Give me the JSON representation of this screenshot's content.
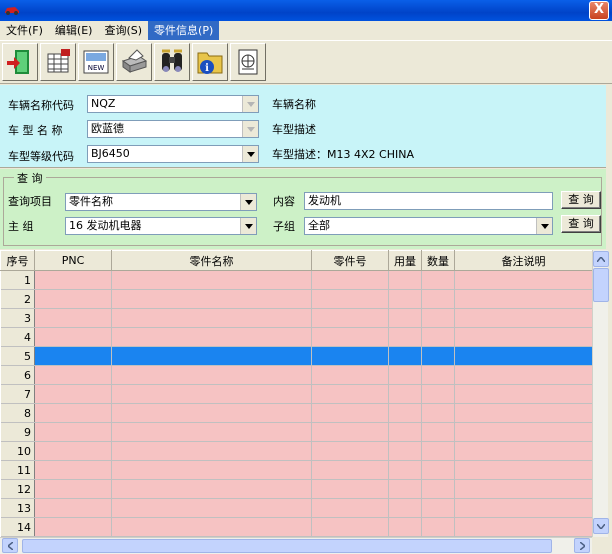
{
  "window": {
    "close_label": "X"
  },
  "menu": [
    {
      "label": "文件(F)"
    },
    {
      "label": "编辑(E)"
    },
    {
      "label": "查询(S)"
    },
    {
      "label": "零件信息(P)"
    }
  ],
  "toolbar_icons": [
    "exit-door-icon",
    "table-print-icon",
    "new-doc-icon",
    "printer-icon",
    "binoculars-icon",
    "info-folder-icon",
    "drawing-icon"
  ],
  "vehicle": {
    "code_label": "车辆名称代码",
    "code_value": "NQZ",
    "name_label": "车辆名称",
    "type_label": "车 型 名 称",
    "type_value": "欧蓝德",
    "type_desc_label": "车型描述",
    "grade_label": "车型等级代码",
    "grade_value": "BJ6450",
    "grade_desc": "车型描述：M13 4X2  CHINA"
  },
  "query": {
    "group_title": "查 询",
    "item_label": "查询项目",
    "item_value": "零件名称",
    "content_label": "内容",
    "content_value": "发动机",
    "query_button": "查 询",
    "main_label": "主   组",
    "main_value": "16  发动机电器",
    "sub_label": "子组",
    "sub_value": "全部",
    "query_button2": "查 询"
  },
  "table": {
    "headers": [
      "序号",
      "PNC",
      "零件名称",
      "零件号",
      "用量",
      "数量",
      "备注说明"
    ],
    "rows": [
      "1",
      "2",
      "3",
      "4",
      "5",
      "6",
      "7",
      "8",
      "9",
      "10",
      "11",
      "12",
      "13",
      "14"
    ],
    "selected_row": 5
  },
  "colors": {
    "grid_row": "#f6c3c3",
    "selected": "#1a84f0",
    "panel_top": "#c8f4f8",
    "panel_query": "#cdf1c7"
  }
}
